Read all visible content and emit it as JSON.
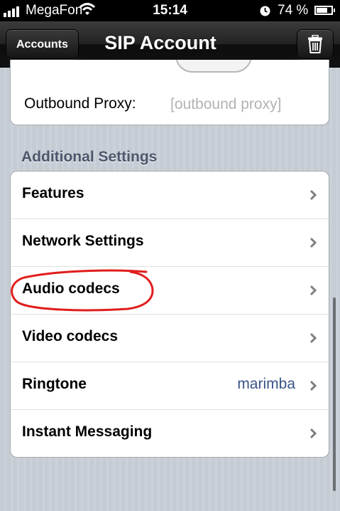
{
  "status_bar": {
    "carrier": "MegaFon",
    "time": "15:14",
    "battery_percent": "74 %",
    "battery_level": 0.74
  },
  "nav": {
    "back_label": "Accounts",
    "title": "SIP Account",
    "right_icon": "trash-icon"
  },
  "top_group": {
    "proxy_label": "Outbound Proxy:",
    "proxy_value": "",
    "proxy_placeholder": "[outbound proxy]"
  },
  "additional_settings": {
    "header": "Additional Settings",
    "rows": [
      {
        "label": "Features",
        "value": ""
      },
      {
        "label": "Network Settings",
        "value": ""
      },
      {
        "label": "Audio codecs",
        "value": ""
      },
      {
        "label": "Video codecs",
        "value": ""
      },
      {
        "label": "Ringtone",
        "value": "marimba"
      },
      {
        "label": "Instant Messaging",
        "value": ""
      }
    ]
  },
  "colors": {
    "annotation": "#e11d1d",
    "value_text": "#385487",
    "section_header": "#4c566c"
  }
}
